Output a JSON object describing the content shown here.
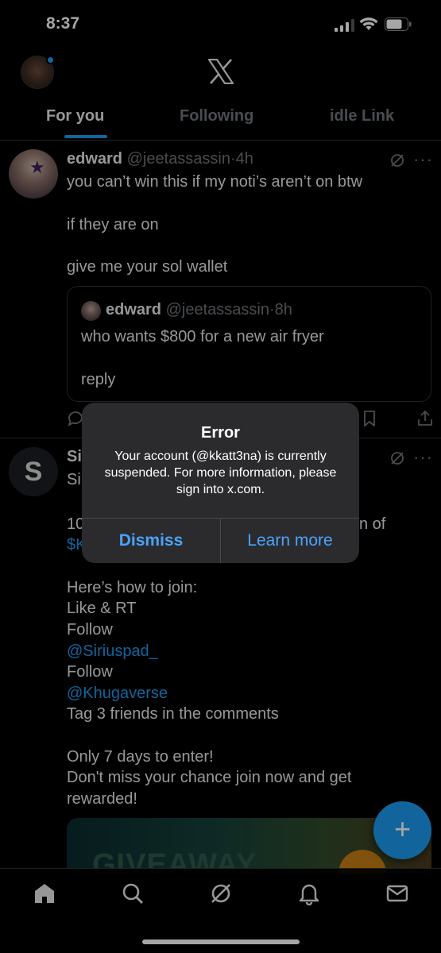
{
  "status_bar": {
    "time": "8:37"
  },
  "header": {
    "tabs": [
      {
        "label": "For you",
        "active": true
      },
      {
        "label": "Following",
        "active": false
      },
      {
        "label": "idle Link",
        "active": false
      }
    ]
  },
  "tweets": [
    {
      "name": "edward",
      "handle": "@jeetassassin",
      "time": "4h",
      "lines": [
        "you can’t win this if my noti’s aren’t on btw",
        "if they are on",
        "give me your sol wallet"
      ],
      "quote": {
        "name": "edward",
        "handle": "@jeetassassin",
        "time": "8h",
        "lines": [
          "who wants $800 for a new air fryer",
          "reply"
        ]
      }
    },
    {
      "name_partial": "Si",
      "line1_partial": "Si",
      "line2_left": "10",
      "line2_right": "n of",
      "line3_partial": "$K",
      "lines": [
        "Here’s how to join:",
        "Like & RT",
        "Follow",
        "@Siriuspad_",
        "Follow",
        "@Khugaverse",
        "Tag 3 friends in the comments",
        "Only 7 days to enter!",
        "Don't miss your chance join now and get",
        "rewarded!"
      ],
      "media_text": "GIVEAWAY"
    }
  ],
  "alert": {
    "title": "Error",
    "message": "Your account (@kkatt3na) is currently suspended. For more information, please sign into x.com.",
    "buttons": {
      "dismiss": "Dismiss",
      "learn_more": "Learn more"
    }
  },
  "colors": {
    "accent": "#1d9bf0",
    "background": "#000000",
    "alert_bg": "#2c2c2e",
    "alert_button": "#4aa3ff"
  },
  "icons": [
    "x-logo-icon",
    "grok-icon",
    "more-icon",
    "reply-icon",
    "bookmark-icon",
    "share-icon",
    "plus-icon",
    "home-icon",
    "search-icon",
    "notifications-icon",
    "messages-icon"
  ]
}
